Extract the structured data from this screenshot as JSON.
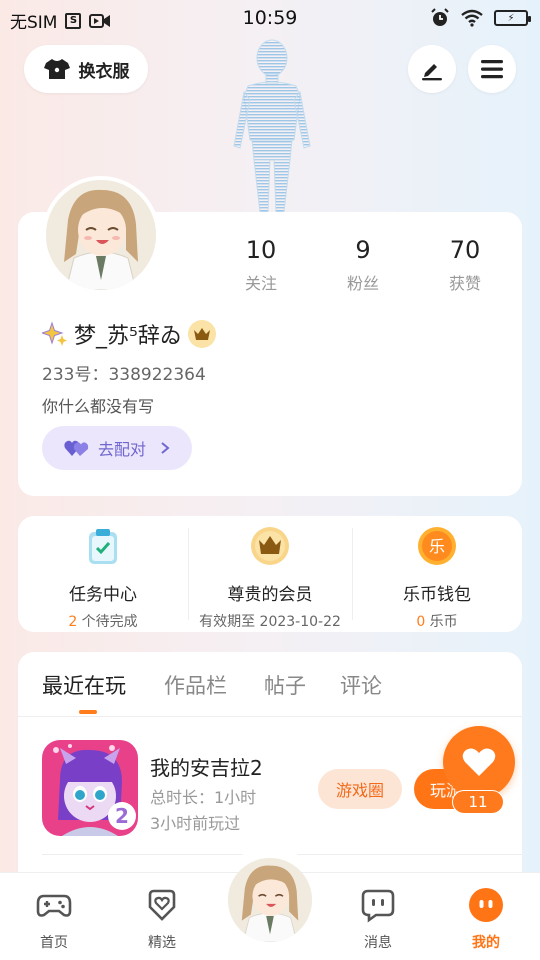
{
  "status_bar": {
    "carrier": "无SIM",
    "time": "10:59"
  },
  "top": {
    "wardrobe_label": "换衣服"
  },
  "profile": {
    "stats": [
      {
        "value": "10",
        "label": "关注"
      },
      {
        "value": "9",
        "label": "粉丝"
      },
      {
        "value": "70",
        "label": "获赞"
      }
    ],
    "nickname": "梦_苏⁵辞ゐ",
    "uid_label": "233号：",
    "uid": "338922364",
    "bio": "你什么都没有写",
    "match_label": "去配对"
  },
  "quick_entries": [
    {
      "title": "任务中心",
      "count": "2",
      "suffix": " 个待完成",
      "icon": "clipboard-icon"
    },
    {
      "title": "尊贵的会员",
      "sub": "有效期至  2023-10-22",
      "icon": "crown-icon"
    },
    {
      "title": "乐币钱包",
      "count": "0",
      "suffix": " 乐币",
      "icon": "coin-icon",
      "coin_char": "乐"
    }
  ],
  "tabs": [
    "最近在玩",
    "作品栏",
    "帖子",
    "评论"
  ],
  "recent_game": {
    "title": "我的安吉拉2",
    "duration": "总时长：1小时",
    "last_played": "3小时前玩过",
    "circle_label": "游戏圈",
    "play_label": "玩游",
    "icon_badge": "2"
  },
  "fab": {
    "count": "11"
  },
  "bottom_nav": [
    {
      "label": "首页",
      "icon": "gamepad-icon"
    },
    {
      "label": "精选",
      "icon": "heart-box-icon"
    },
    {
      "label": "消息",
      "icon": "chat-icon"
    },
    {
      "label": "我的",
      "icon": "me-icon"
    }
  ],
  "colors": {
    "accent": "#ff7415",
    "purple": "#7066d0"
  }
}
